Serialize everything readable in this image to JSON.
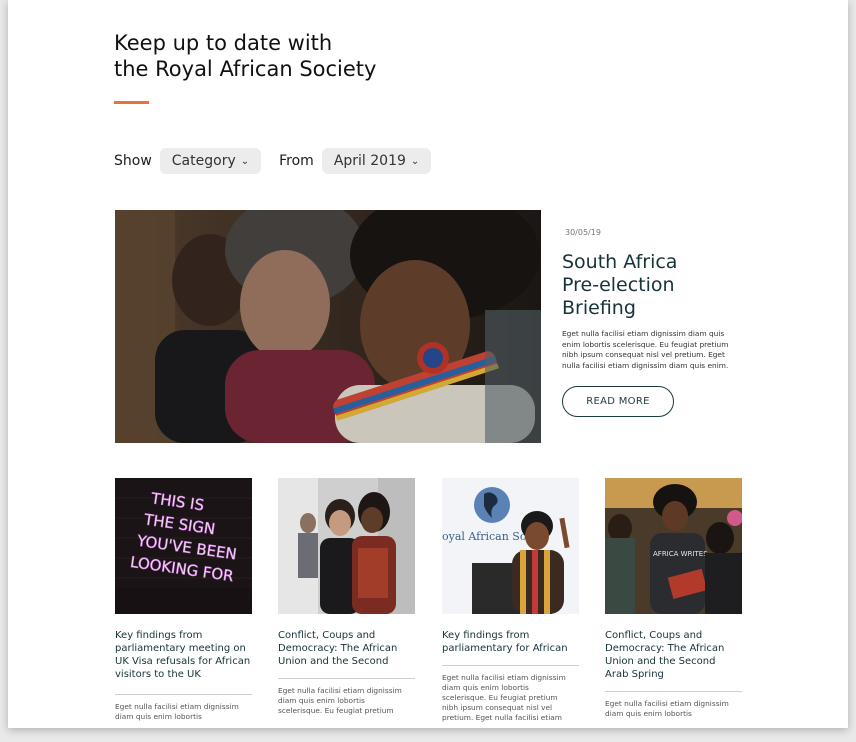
{
  "header": {
    "title_line1": "Keep up to date with",
    "title_line2": "the Royal African Society",
    "accent_color": "#e6743a"
  },
  "filters": {
    "show_label": "Show",
    "category_value": "Category",
    "from_label": "From",
    "date_value": "April 2019",
    "chevron_icon": "chevron-down-icon"
  },
  "featured": {
    "date": "30/05/19",
    "title_lines": [
      "South Africa",
      "Pre-election",
      "Briefing"
    ],
    "body_lines": [
      "Eget nulla facilisi etiam dignissim diam quis",
      "enim lobortis scelerisque. Eu feugiat pretium",
      "nibh ipsum consequat nisl vel pretium. Eget",
      "nulla facilisi etiam dignissim diam quis enim."
    ],
    "button_label": "READ MORE"
  },
  "cards": [
    {
      "title_lines": [
        "Key findings from",
        "parliamentary meeting on",
        "UK Visa refusals for African",
        "visitors to the UK"
      ],
      "body_lines": [
        "Eget nulla facilisi etiam dignissim",
        "diam quis enim lobortis"
      ],
      "neon_lines": [
        "THIS IS",
        "THE SIGN",
        "YOU'VE BEEN",
        "LOOKING FOR"
      ]
    },
    {
      "title_lines": [
        "Conflict, Coups and",
        "Democracy: The African",
        "Union and the Second"
      ],
      "body_lines": [
        "Eget nulla facilisi etiam dignissim",
        "diam quis enim lobortis",
        "scelerisque. Eu feugiat pretium"
      ]
    },
    {
      "title_lines": [
        "Key findings from",
        "parliamentary for African"
      ],
      "body_lines": [
        "Eget nulla facilisi etiam dignissim",
        "diam quis enim lobortis",
        "scelerisque. Eu feugiat pretium",
        "nibh ipsum consequat nisl vel",
        "pretium. Eget nulla facilisi etiam"
      ],
      "banner_text": "oyal African So"
    },
    {
      "title_lines": [
        "Conflict, Coups and",
        "Democracy: The African",
        "Union and the Second",
        "Arab Spring"
      ],
      "body_lines": [
        "Eget nulla facilisi etiam dignissim",
        "diam quis enim lobortis"
      ],
      "book_text": "AFRICA WRITES"
    }
  ]
}
